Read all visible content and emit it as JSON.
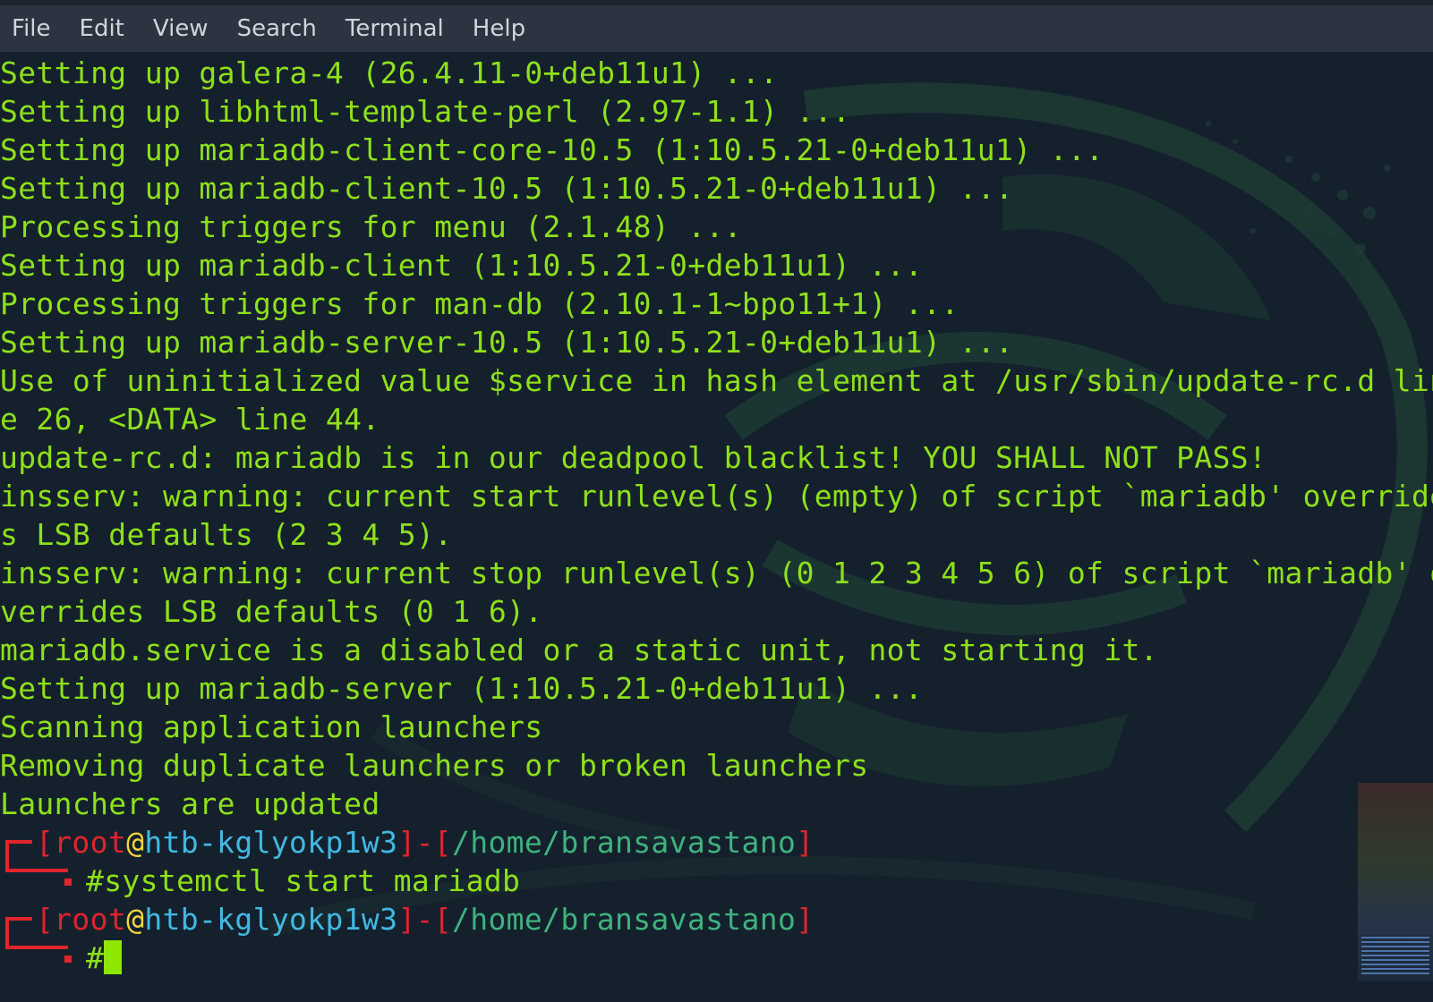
{
  "menu": {
    "items": [
      "File",
      "Edit",
      "View",
      "Search",
      "Terminal",
      "Help"
    ]
  },
  "terminal": {
    "output_lines": [
      "Setting up galera-4 (26.4.11-0+deb11u1) ...",
      "Setting up libhtml-template-perl (2.97-1.1) ...",
      "Setting up mariadb-client-core-10.5 (1:10.5.21-0+deb11u1) ...",
      "Setting up mariadb-client-10.5 (1:10.5.21-0+deb11u1) ...",
      "Processing triggers for menu (2.1.48) ...",
      "Setting up mariadb-client (1:10.5.21-0+deb11u1) ...",
      "Processing triggers for man-db (2.10.1-1~bpo11+1) ...",
      "Setting up mariadb-server-10.5 (1:10.5.21-0+deb11u1) ...",
      "Use of uninitialized value $service in hash element at /usr/sbin/update-rc.d lin",
      "e 26, <DATA> line 44.",
      "update-rc.d: mariadb is in our deadpool blacklist! YOU SHALL NOT PASS!",
      "insserv: warning: current start runlevel(s) (empty) of script `mariadb' override",
      "s LSB defaults (2 3 4 5).",
      "insserv: warning: current stop runlevel(s) (0 1 2 3 4 5 6) of script `mariadb' o",
      "verrides LSB defaults (0 1 6).",
      "mariadb.service is a disabled or a static unit, not starting it.",
      "Setting up mariadb-server (1:10.5.21-0+deb11u1) ...",
      "Scanning application launchers",
      "Removing duplicate launchers or broken launchers",
      "Launchers are updated"
    ],
    "prompts": [
      {
        "user": "root",
        "at": "@",
        "host": "htb-kglyokp1w3",
        "separator": "]-[",
        "path": "/home/bransavastano",
        "symbol": "#",
        "command": "systemctl start mariadb"
      },
      {
        "user": "root",
        "at": "@",
        "host": "htb-kglyokp1w3",
        "separator": "]-[",
        "path": "/home/bransavastano",
        "symbol": "#",
        "command": ""
      }
    ]
  },
  "colors": {
    "output_green": "#8fe01a",
    "prompt_red": "#e0242c",
    "at_yellow": "#f4d43b",
    "host_cyan": "#41b9e2",
    "path_green": "#3fb27f",
    "background": "#14212d",
    "menubar": "#2b3440"
  }
}
